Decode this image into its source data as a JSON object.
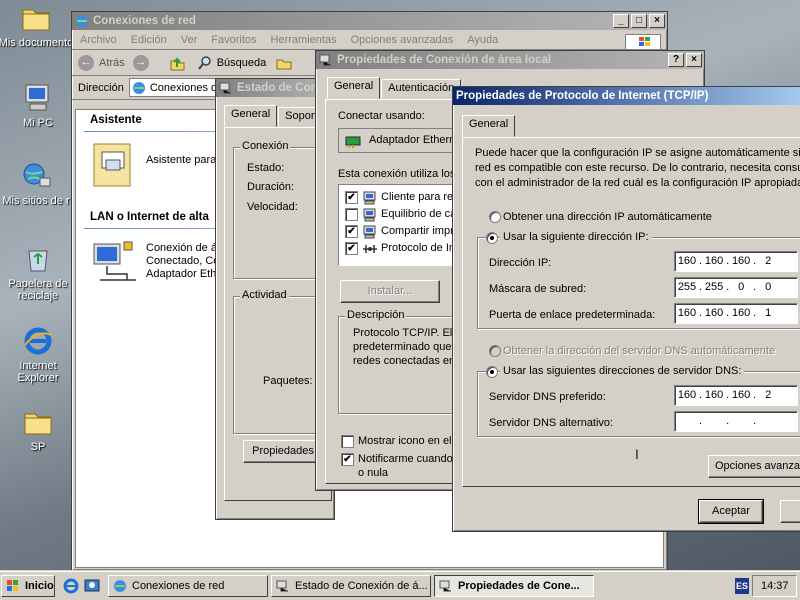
{
  "desktop": {
    "icons": [
      {
        "label": "Mis documento"
      },
      {
        "label": "Mi PC"
      },
      {
        "label": "Mis sitios de r"
      },
      {
        "label": "Papelera de reciclaje"
      },
      {
        "label": "Internet Explorer"
      },
      {
        "label": "SP"
      }
    ]
  },
  "explorer": {
    "title": "Conexiones de red",
    "menu": [
      "Archivo",
      "Edición",
      "Ver",
      "Favoritos",
      "Herramientas",
      "Opciones avanzadas",
      "Ayuda"
    ],
    "toolbar": {
      "back": "Atrás",
      "search": "Búsqueda"
    },
    "address_label": "Dirección",
    "address_value": "Conexiones de",
    "sections": {
      "wizard": "Asistente",
      "lan": "LAN o Internet de alta"
    },
    "wizard_item": "Asistente para",
    "connection_item": {
      "name": "Conexión de á",
      "status": "Conectado, Co",
      "device": "Adaptador Eth"
    }
  },
  "status_dialog": {
    "title": "Estado de Con",
    "tabs": [
      "General",
      "Soporte"
    ],
    "connection_group": "Conexión",
    "status_label": "Estado:",
    "duration_label": "Duración:",
    "speed_label": "Velocidad:",
    "activity_group": "Actividad",
    "packets_label": "Paquetes:",
    "properties_button": "Propiedades"
  },
  "lan_props": {
    "title": "Propiedades de Conexión de área local",
    "tabs": [
      "General",
      "Autenticación"
    ],
    "connect_using": "Conectar usando:",
    "adapter": "Adaptador Ethern",
    "uses_label": "Esta conexión utiliza los",
    "components": [
      {
        "label": "Cliente para red",
        "checked": true
      },
      {
        "label": "Equilibrio de ca",
        "checked": false
      },
      {
        "label": "Compartir impre",
        "checked": true
      },
      {
        "label": "Protocolo de In",
        "checked": true
      }
    ],
    "install_button": "Instalar...",
    "description_group": "Descripción",
    "description_text": [
      "Protocolo TCP/IP. El",
      "predeterminado que p",
      "redes conectadas en"
    ],
    "show_icon": "Mostrar icono en el a",
    "notify": "Notificarme cuando",
    "notify2": "o nula"
  },
  "tcpip": {
    "title": "Propiedades de Protocolo de Internet (TCP/IP)",
    "tab": "General",
    "intro": [
      "Puede hacer que la configuración IP se asigne automáticamente si su",
      "red es compatible con este recurso. De lo contrario, necesita consu",
      "con el administrador de la red cuál es la configuración IP apropiada."
    ],
    "auto_ip": "Obtener una dirección IP automáticamente",
    "manual_ip": "Usar la siguiente dirección IP:",
    "ip_label": "Dirección IP:",
    "ip_value": [
      "160",
      "160",
      "160",
      "2"
    ],
    "mask_label": "Máscara de subred:",
    "mask_value": [
      "255",
      "255",
      "0",
      "0"
    ],
    "gateway_label": "Puerta de enlace predeterminada:",
    "gateway_value": [
      "160",
      "160",
      "160",
      "1"
    ],
    "auto_dns": "Obtener la dirección del servidor DNS automáticamente",
    "manual_dns": "Usar las siguientes direcciones de servidor DNS:",
    "dns_pref_label": "Servidor DNS preferido:",
    "dns_pref_value": [
      "160",
      "160",
      "160",
      "2"
    ],
    "dns_alt_label": "Servidor DNS alternativo:",
    "dns_alt_value": [
      "",
      "",
      "",
      ""
    ],
    "advanced_button": "Opciones avanzadas...",
    "ok_button": "Aceptar"
  },
  "taskbar": {
    "start": "Inicio",
    "tasks": [
      "Conexiones de red",
      "Estado de Conexión de á...",
      "Propiedades de Cone..."
    ],
    "lang": "ES",
    "clock": "14:37"
  },
  "colors": {
    "active_title": "#0a246a",
    "inactive_title": "#808080",
    "face": "#d4d0c8"
  }
}
